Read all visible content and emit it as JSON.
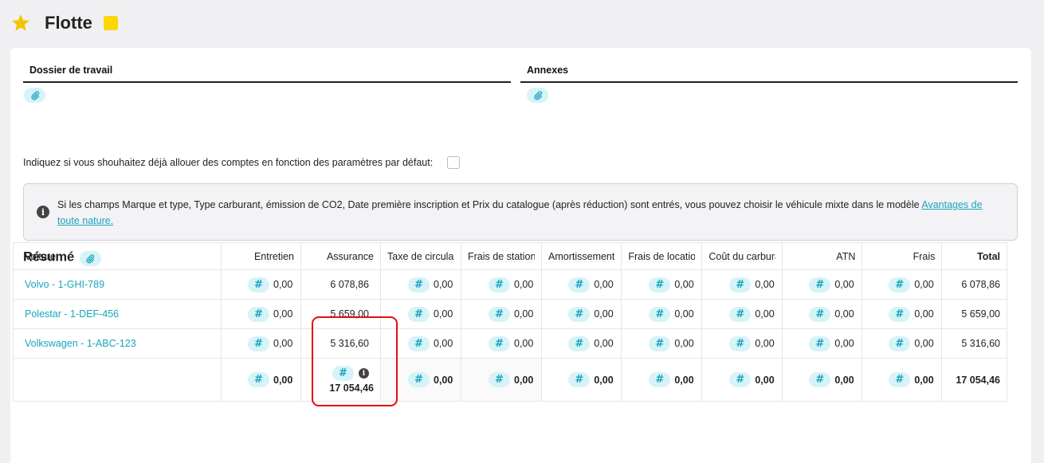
{
  "header": {
    "title": "Flotte"
  },
  "work_folder": {
    "label": "Dossier de travail"
  },
  "annexes": {
    "label": "Annexes"
  },
  "allocate_question": "Indiquez si vous shouhaitez déjà allouer des comptes en fonction des paramètres par défaut:",
  "info": {
    "text": "Si les champs Marque et type, Type carburant, émission de CO2, Date première inscription et Prix du catalogue (après réduction) sont entrés, vous pouvez choisir le véhicule mixte dans le modèle ",
    "link": "Avantages de toute nature."
  },
  "resume": {
    "title": "Résumé"
  },
  "table": {
    "headers": {
      "car": "Voiture",
      "maintenance": "Entretien",
      "insurance": "Assurance",
      "tax": "Taxe de circulation",
      "parking": "Frais de stationnement",
      "depreciation": "Amortissement",
      "rental": "Frais de location",
      "fuel": "Coût du carburant",
      "atn": "ATN",
      "fees": "Frais",
      "total": "Total"
    },
    "rows": [
      {
        "car": "Volvo - 1-GHI-789",
        "maintenance": "0,00",
        "insurance": "6 078,86",
        "tax": "0,00",
        "parking": "0,00",
        "depreciation": "0,00",
        "rental": "0,00",
        "fuel": "0,00",
        "atn": "0,00",
        "fees": "0,00",
        "total": "6 078,86"
      },
      {
        "car": "Polestar - 1-DEF-456",
        "maintenance": "0,00",
        "insurance": "5 659,00",
        "tax": "0,00",
        "parking": "0,00",
        "depreciation": "0,00",
        "rental": "0,00",
        "fuel": "0,00",
        "atn": "0,00",
        "fees": "0,00",
        "total": "5 659,00"
      },
      {
        "car": "Volkswagen - 1-ABC-123",
        "maintenance": "0,00",
        "insurance": "5 316,60",
        "tax": "0,00",
        "parking": "0,00",
        "depreciation": "0,00",
        "rental": "0,00",
        "fuel": "0,00",
        "atn": "0,00",
        "fees": "0,00",
        "total": "5 316,60"
      }
    ],
    "totals": {
      "maintenance": "0,00",
      "insurance": "17 054,46",
      "tax": "0,00",
      "parking": "0,00",
      "depreciation": "0,00",
      "rental": "0,00",
      "fuel": "0,00",
      "atn": "0,00",
      "fees": "0,00",
      "total": "17 054,46"
    },
    "hash_symbol": "#"
  },
  "colors": {
    "accent": "#19a4be",
    "chip_bg": "#d6f3f8",
    "star": "#f5c400",
    "note": "#ffd600",
    "highlight": "#e01010"
  }
}
